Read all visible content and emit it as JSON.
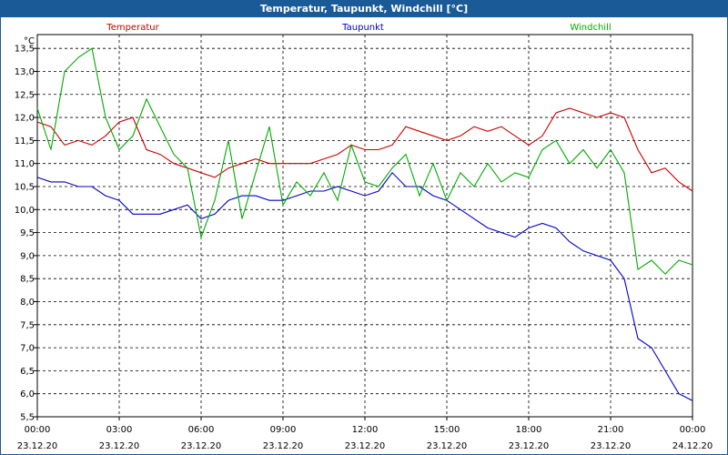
{
  "window": {
    "title": "Temperatur, Taupunkt, Windchill [°C]"
  },
  "chart_data": {
    "type": "line",
    "title": "Temperatur, Taupunkt, Windchill [°C]",
    "ylabel": "°C",
    "ylim": [
      5.5,
      13.8
    ],
    "yticks": [
      "5,5",
      "6,0",
      "6,5",
      "7,0",
      "7,5",
      "8,0",
      "8,5",
      "9,0",
      "9,5",
      "10,0",
      "10,5",
      "11,0",
      "11,5",
      "12,0",
      "12,5",
      "13,0",
      "13,5"
    ],
    "xticks": [
      {
        "time": "00:00",
        "date": "23.12.20"
      },
      {
        "time": "03:00",
        "date": "23.12.20"
      },
      {
        "time": "06:00",
        "date": "23.12.20"
      },
      {
        "time": "09:00",
        "date": "23.12.20"
      },
      {
        "time": "12:00",
        "date": "23.12.20"
      },
      {
        "time": "15:00",
        "date": "23.12.20"
      },
      {
        "time": "18:00",
        "date": "23.12.20"
      },
      {
        "time": "21:00",
        "date": "23.12.20"
      },
      {
        "time": "00:00",
        "date": "24.12.20"
      }
    ],
    "x_hours": [
      0,
      0.5,
      1,
      1.5,
      2,
      2.5,
      3,
      3.5,
      4,
      4.5,
      5,
      5.5,
      6,
      6.5,
      7,
      7.5,
      8,
      8.5,
      9,
      9.5,
      10,
      10.5,
      11,
      11.5,
      12,
      12.5,
      13,
      13.5,
      14,
      14.5,
      15,
      15.5,
      16,
      16.5,
      17,
      17.5,
      18,
      18.5,
      19,
      19.5,
      20,
      20.5,
      21,
      21.5,
      22,
      22.5,
      23,
      23.5,
      24
    ],
    "grid": true,
    "series": [
      {
        "name": "Temperatur",
        "color": "#cc0000",
        "values": [
          11.9,
          11.8,
          11.4,
          11.5,
          11.4,
          11.6,
          11.9,
          12.0,
          11.3,
          11.2,
          11.0,
          10.9,
          10.8,
          10.7,
          10.9,
          11.0,
          11.1,
          11.0,
          11.0,
          11.0,
          11.0,
          11.1,
          11.2,
          11.4,
          11.3,
          11.3,
          11.4,
          11.8,
          11.7,
          11.6,
          11.5,
          11.6,
          11.8,
          11.7,
          11.8,
          11.6,
          11.4,
          11.6,
          12.1,
          12.2,
          12.1,
          12.0,
          12.1,
          12.0,
          11.3,
          10.8,
          10.9,
          10.6,
          10.4
        ]
      },
      {
        "name": "Taupunkt",
        "color": "#0000cc",
        "values": [
          10.7,
          10.6,
          10.6,
          10.5,
          10.5,
          10.3,
          10.2,
          9.9,
          9.9,
          9.9,
          10.0,
          10.1,
          9.8,
          9.9,
          10.2,
          10.3,
          10.3,
          10.2,
          10.2,
          10.3,
          10.4,
          10.4,
          10.5,
          10.4,
          10.3,
          10.4,
          10.8,
          10.5,
          10.5,
          10.3,
          10.2,
          10.0,
          9.8,
          9.6,
          9.5,
          9.4,
          9.6,
          9.7,
          9.6,
          9.3,
          9.1,
          9.0,
          8.9,
          8.5,
          7.2,
          7.0,
          6.5,
          6.0,
          5.85
        ]
      },
      {
        "name": "Windchill",
        "color": "#00aa00",
        "values": [
          12.2,
          11.3,
          13.0,
          13.3,
          13.5,
          12.0,
          11.3,
          11.6,
          12.4,
          11.8,
          11.2,
          10.9,
          9.4,
          10.2,
          11.5,
          9.8,
          10.8,
          11.8,
          10.1,
          10.6,
          10.3,
          10.8,
          10.2,
          11.4,
          10.6,
          10.5,
          10.9,
          11.2,
          10.3,
          11.0,
          10.2,
          10.8,
          10.5,
          11.0,
          10.6,
          10.8,
          10.7,
          11.3,
          11.5,
          11.0,
          11.3,
          10.9,
          11.3,
          10.8,
          8.7,
          8.9,
          8.6,
          8.9,
          8.8
        ]
      }
    ]
  }
}
